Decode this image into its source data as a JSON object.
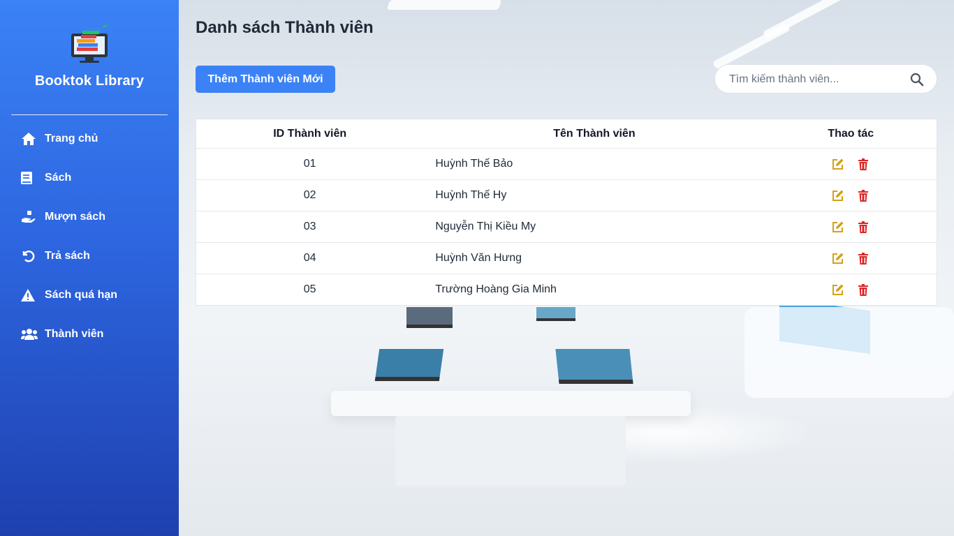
{
  "app": {
    "name": "Booktok Library"
  },
  "sidebar": {
    "items": [
      {
        "label": "Trang chủ",
        "icon": "home-icon"
      },
      {
        "label": "Sách",
        "icon": "book-icon"
      },
      {
        "label": "Mượn sách",
        "icon": "hand-holding-icon"
      },
      {
        "label": "Trả sách",
        "icon": "undo-icon"
      },
      {
        "label": "Sách quá hạn",
        "icon": "warning-icon"
      },
      {
        "label": "Thành viên",
        "icon": "users-icon"
      }
    ]
  },
  "page": {
    "title": "Danh sách Thành viên",
    "add_button": "Thêm Thành viên Mới",
    "search_placeholder": "Tìm kiếm thành viên..."
  },
  "table": {
    "columns": [
      "ID Thành viên",
      "Tên Thành viên",
      "Thao tác"
    ],
    "rows": [
      {
        "id": "01",
        "name": "Huỳnh Thế Bảo"
      },
      {
        "id": "02",
        "name": "Huỳnh Thế Hy"
      },
      {
        "id": "03",
        "name": "Nguyễn Thị Kiều My"
      },
      {
        "id": "04",
        "name": "Huỳnh Văn Hưng"
      },
      {
        "id": "05",
        "name": "Trường Hoàng Gia Minh"
      }
    ]
  },
  "colors": {
    "sidebar_top": "#3b82f6",
    "sidebar_bottom": "#1e40af",
    "primary_button": "#3b82f6",
    "edit_icon": "#d4a017",
    "delete_icon": "#dc2626"
  }
}
